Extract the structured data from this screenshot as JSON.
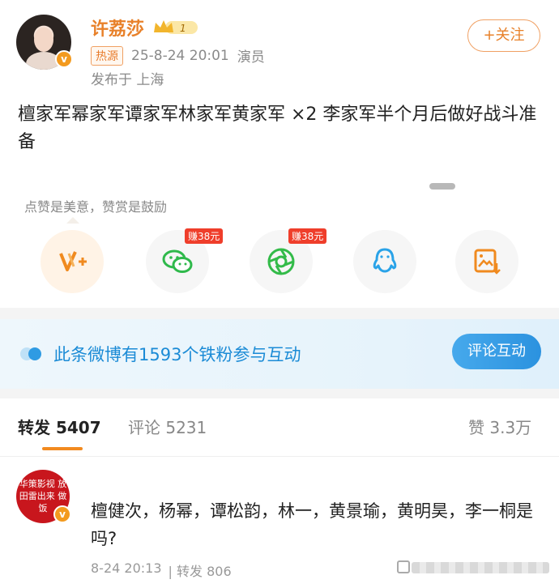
{
  "header": {
    "username": "许荔莎",
    "vip_badge": "1",
    "hot_badge": "热源",
    "timestamp": "25-8-24 20:01",
    "role": "演员",
    "location": "发布于 上海",
    "follow_label": "+关注"
  },
  "post": {
    "text": "檀家军幂家军谭家军林家军黄家军 ×2 李家军半个月后做好战斗准备"
  },
  "reward": {
    "label": "点赞是美意，赞赏是鼓励",
    "share_items": [
      {
        "icon": "weibo-v-plus-icon",
        "tag": ""
      },
      {
        "icon": "wechat-icon",
        "tag": "赚38元"
      },
      {
        "icon": "moments-icon",
        "tag": "赚38元"
      },
      {
        "icon": "qq-icon",
        "tag": ""
      },
      {
        "icon": "save-image-icon",
        "tag": ""
      }
    ]
  },
  "fan_banner": {
    "text": "此条微博有1593个铁粉参与互动",
    "button": "评论互动"
  },
  "tabs": {
    "repost": "转发 5407",
    "comment": "评论 5231",
    "like": "赞 3.3万"
  },
  "comment": {
    "avatar_text": "华策影视 放田雷出来 做饭",
    "text": "檀健次，杨幂，谭松韵，林一，黄景瑜，黄明昊，李一桐是吗?",
    "time": "8-24 20:13",
    "repost": "| 转发 806"
  },
  "colors": {
    "accent": "#e8812a",
    "blue": "#1b8bd6",
    "red_tag": "#ef3e2b"
  }
}
